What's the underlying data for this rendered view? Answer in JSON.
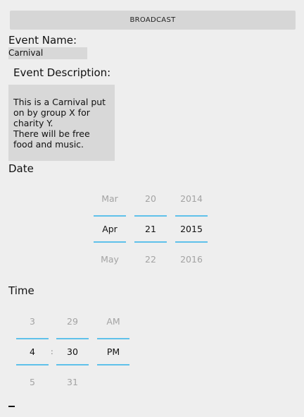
{
  "broadcast_button": "BROADCAST",
  "event_name": {
    "label": "Event Name:",
    "value": "Carnival"
  },
  "event_description": {
    "label": "Event Description:",
    "value": "This is a Carnival put on by group X for charity Y.\nThere will be free food and music."
  },
  "date": {
    "label": "Date",
    "month": {
      "prev": "Mar",
      "selected": "Apr",
      "next": "May"
    },
    "day": {
      "prev": "20",
      "selected": "21",
      "next": "22"
    },
    "year": {
      "prev": "2014",
      "selected": "2015",
      "next": "2016"
    }
  },
  "time": {
    "label": "Time",
    "hour": {
      "prev": "3",
      "selected": "4",
      "next": "5"
    },
    "separator": ":",
    "minute": {
      "prev": "29",
      "selected": "30",
      "next": "31"
    },
    "ampm": {
      "prev": "AM",
      "selected": "PM"
    }
  },
  "colors": {
    "accent": "#5fc1ea",
    "background": "#eeeeee",
    "field": "#d8d8d8"
  }
}
